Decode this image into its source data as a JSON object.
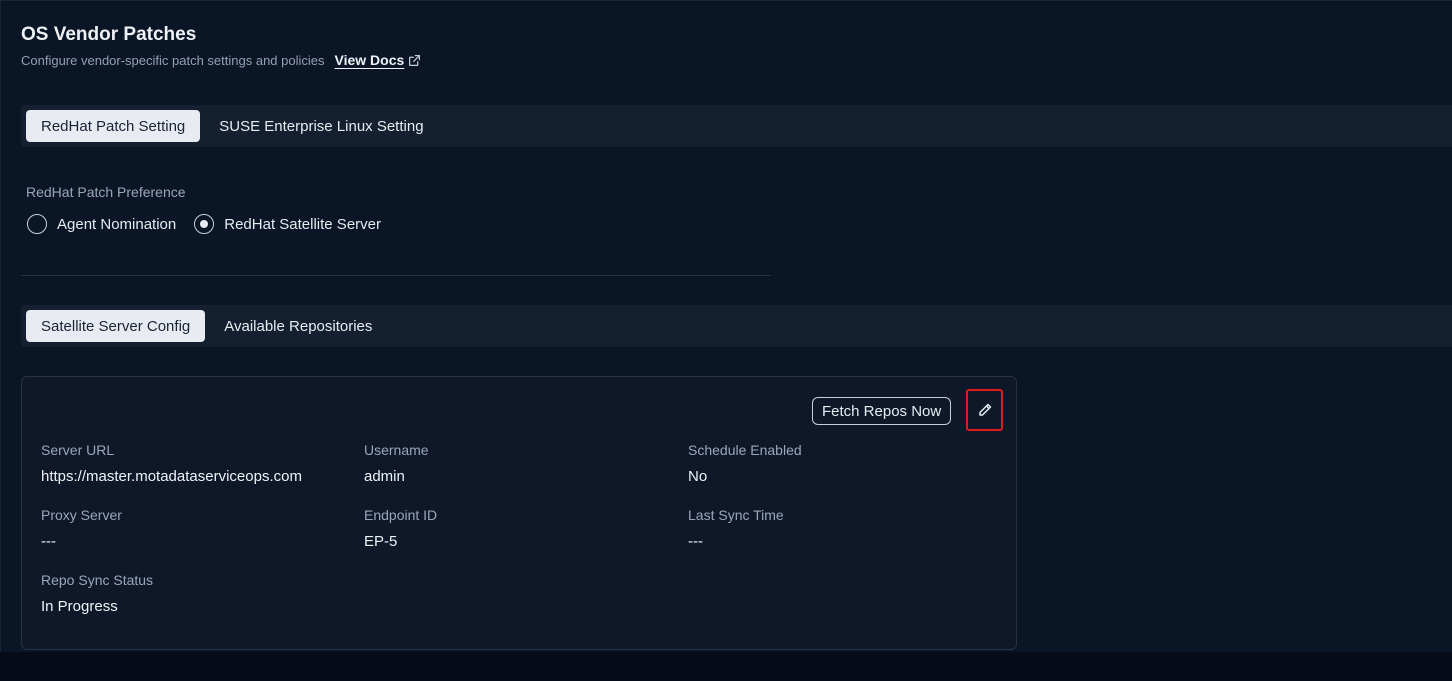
{
  "header": {
    "title": "OS Vendor Patches",
    "subtitle": "Configure vendor-specific patch settings and policies",
    "docs_label": "View Docs"
  },
  "vendor_tabs": [
    {
      "label": "RedHat Patch Setting",
      "active": true
    },
    {
      "label": "SUSE Enterprise Linux Setting",
      "active": false
    }
  ],
  "preference": {
    "label": "RedHat Patch Preference",
    "options": [
      {
        "label": "Agent Nomination",
        "selected": false
      },
      {
        "label": "RedHat Satellite Server",
        "selected": true
      }
    ]
  },
  "config_tabs": [
    {
      "label": "Satellite Server Config",
      "active": true
    },
    {
      "label": "Available Repositories",
      "active": false
    }
  ],
  "card": {
    "fetch_label": "Fetch Repos Now",
    "fields": {
      "server_url": {
        "label": "Server URL",
        "value": "https://master.motadataserviceops.com"
      },
      "username": {
        "label": "Username",
        "value": "admin"
      },
      "schedule_enabled": {
        "label": "Schedule Enabled",
        "value": "No"
      },
      "proxy_server": {
        "label": "Proxy Server",
        "value": "---"
      },
      "endpoint_id": {
        "label": "Endpoint ID",
        "value": "EP-5"
      },
      "last_sync_time": {
        "label": "Last Sync Time",
        "value": "---"
      },
      "repo_sync_status": {
        "label": "Repo Sync Status",
        "value": "In Progress"
      }
    }
  },
  "icons": {
    "docs": "external-link-icon",
    "edit": "pencil-icon"
  }
}
